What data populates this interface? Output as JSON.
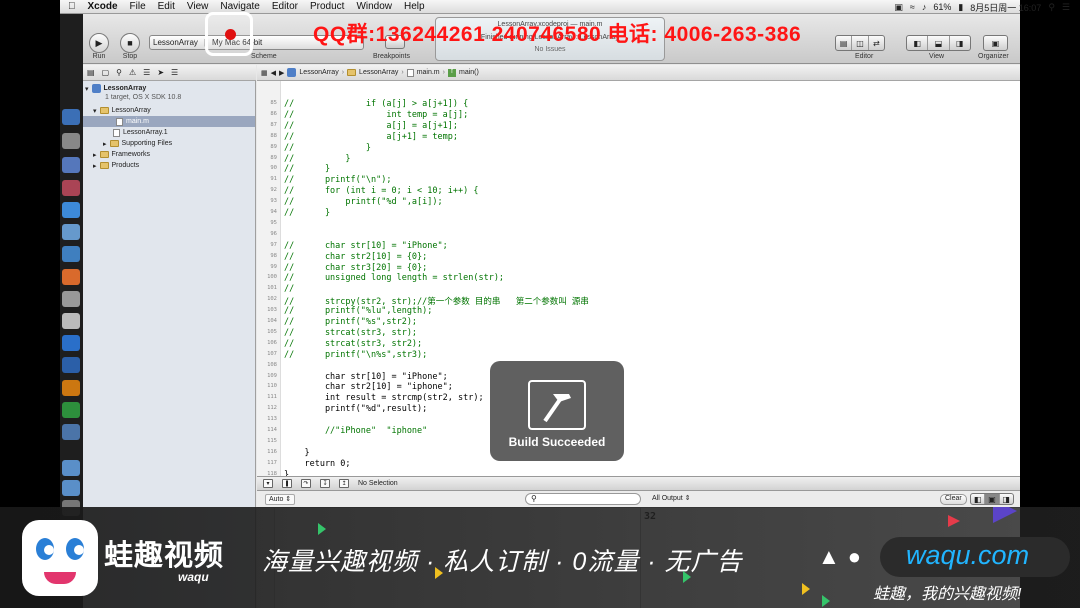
{
  "menubar": {
    "apple": "",
    "items": [
      "Xcode",
      "File",
      "Edit",
      "View",
      "Navigate",
      "Editor",
      "Product",
      "Window",
      "Help"
    ],
    "battery": "61%",
    "date_time": "8月5日周一  16:07"
  },
  "toolbar": {
    "run_label": "Run",
    "stop_label": "Stop",
    "scheme_target": "LessonArray",
    "scheme_device": "My Mac 64-bit",
    "scheme_label": "Scheme",
    "breakpoints_label": "Breakpoints",
    "status_title": "LessonArray.xcodeproj — main.m",
    "status_message": "Finished running LessonArray : LessonArray",
    "status_sub": "No Issues",
    "editor_label": "Editor",
    "view_label": "View",
    "organizer_label": "Organizer"
  },
  "navigator": {
    "project_name": "LessonArray",
    "project_sub": "1 target, OS X SDK 10.8",
    "group": "LessonArray",
    "files": [
      "main.m",
      "LessonArray.1"
    ],
    "supporting": "Supporting Files",
    "frameworks": "Frameworks",
    "products": "Products"
  },
  "jumpbar": {
    "crumbs": [
      "LessonArray",
      "LessonArray",
      "main.m",
      "main()"
    ]
  },
  "code": [
    {
      "n": "85",
      "t": "//              if (a[j] > a[j+1]) {"
    },
    {
      "n": "86",
      "t": "//                  int temp = a[j];"
    },
    {
      "n": "87",
      "t": "//                  a[j] = a[j+1];"
    },
    {
      "n": "88",
      "t": "//                  a[j+1] = temp;"
    },
    {
      "n": "89",
      "t": "//              }"
    },
    {
      "n": "89",
      "t": "//          }"
    },
    {
      "n": "90",
      "t": "//      }"
    },
    {
      "n": "91",
      "t": "//      printf(\"\\n\");"
    },
    {
      "n": "92",
      "t": "//      for (int i = 0; i < 10; i++) {"
    },
    {
      "n": "93",
      "t": "//          printf(\"%d \",a[i]);"
    },
    {
      "n": "94",
      "t": "//      }"
    },
    {
      "n": "95",
      "t": ""
    },
    {
      "n": "96",
      "t": ""
    },
    {
      "n": "97",
      "t": "//      char str[10] = \"iPhone\";"
    },
    {
      "n": "98",
      "t": "//      char str2[10] = {0};"
    },
    {
      "n": "99",
      "t": "//      char str3[20] = {0};"
    },
    {
      "n": "100",
      "t": "//      unsigned long length = strlen(str);"
    },
    {
      "n": "101",
      "t": "//"
    },
    {
      "n": "102",
      "t": "//      strcpy(str2, str);//第一个参数 目的串   第二个参数叫 源串"
    },
    {
      "n": "103",
      "t": "//      printf(\"%lu\",length);"
    },
    {
      "n": "104",
      "t": "//      printf(\"%s\",str2);"
    },
    {
      "n": "105",
      "t": "//      strcat(str3, str);"
    },
    {
      "n": "106",
      "t": "//      strcat(str3, str2);"
    },
    {
      "n": "107",
      "t": "//      printf(\"\\n%s\",str3);"
    },
    {
      "n": "108",
      "t": ""
    },
    {
      "n": "109",
      "t": "        char str[10] = \"iPhone\";"
    },
    {
      "n": "110",
      "t": "        char str2[10] = \"iphone\";"
    },
    {
      "n": "111",
      "t": "        int result = strcmp(str2, str);"
    },
    {
      "n": "112",
      "t": "        printf(\"%d\",result);"
    },
    {
      "n": "113",
      "t": ""
    },
    {
      "n": "114",
      "t": "        //\"iPhone\"  \"iphone\""
    },
    {
      "n": "115",
      "t": ""
    },
    {
      "n": "116",
      "t": "    }"
    },
    {
      "n": "117",
      "t": "    return 0;"
    },
    {
      "n": "118",
      "t": "}"
    }
  ],
  "debugbar": {
    "selection": "No Selection"
  },
  "console": {
    "variables_mode": "Auto",
    "output_mode": "All Output",
    "clear_label": "Clear",
    "output_text": "32"
  },
  "hud": {
    "text": "Build Succeeded"
  },
  "overlay": {
    "qq_text": "QQ群:136244261   240746580  电话: 4006-263-386"
  },
  "banner": {
    "brand_name": "蛙趣视频",
    "brand_sub": "waqu",
    "slogan": "海量兴趣视频 · 私人订制 · 0流量 · 无广告",
    "url": "waqu.com",
    "tagline": "蛙趣，我的兴趣视频!"
  },
  "colors": {
    "overlay_red": "#ff1515",
    "url_blue": "#21b5ff",
    "comment_green": "#007400"
  }
}
